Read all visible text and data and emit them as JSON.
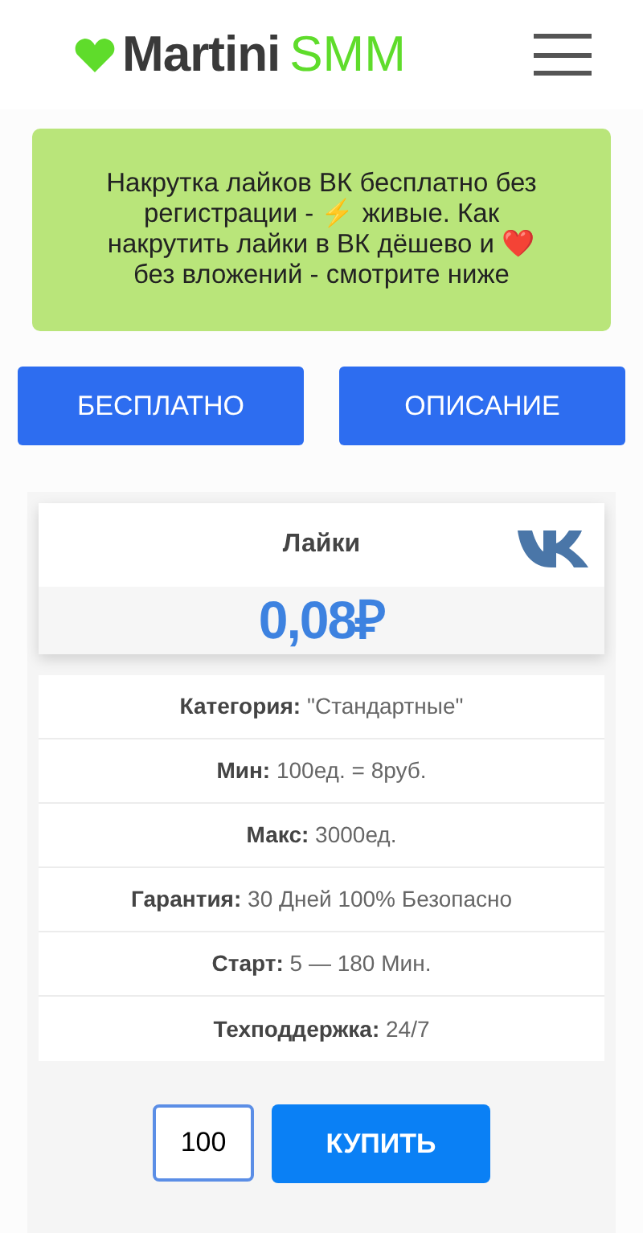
{
  "header": {
    "logo_main": "Martini",
    "logo_accent": "SMM"
  },
  "banner": {
    "text": "Накрутка лайков ВК бесплатно без регистрации - ⚡ живые. Как накрутить лайки в ВК дёшево и ❤️ без вложений - смотрите ниже"
  },
  "buttons": [
    "БЕСПЛАТНО",
    "ОПИСАНИЕ"
  ],
  "card": {
    "title": "Лайки",
    "price": "0,08₽",
    "features": [
      "**Категория:** \"Стандартные\"",
      "**Мин:** 100ед. = 8руб.",
      "**Макс:** 3000ед.",
      "**Гарантия:** 30 Дней 100% Безопасно",
      "**Старт:** 5 — 180 Мин.",
      "**Техподдержка:** 24/7"
    ],
    "quantity": "100",
    "buy_button": "КУПИТЬ"
  }
}
